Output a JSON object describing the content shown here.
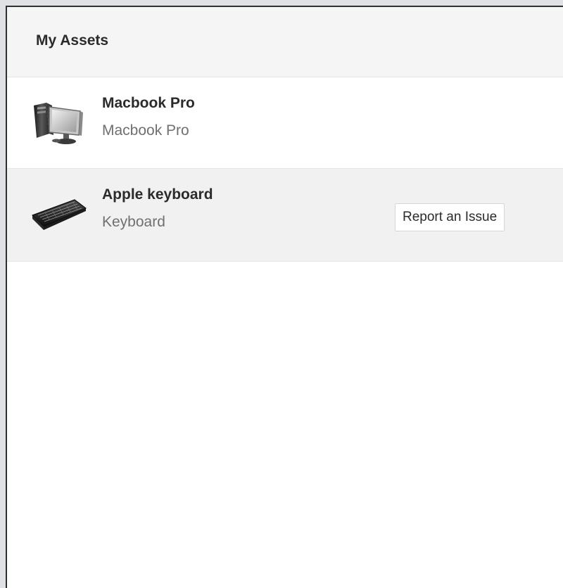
{
  "panel": {
    "title": "My Assets"
  },
  "assets": [
    {
      "name": "Macbook Pro",
      "type": "Macbook Pro",
      "icon": "desktop-computer-icon"
    },
    {
      "name": "Apple keyboard",
      "type": "Keyboard",
      "icon": "keyboard-icon",
      "action_label": "Report an Issue"
    }
  ],
  "colors": {
    "header_background": "#f5f5f5",
    "highlight_row_background": "#f1f1f1",
    "title_text": "#2b2b2b",
    "secondary_text": "#707070"
  }
}
